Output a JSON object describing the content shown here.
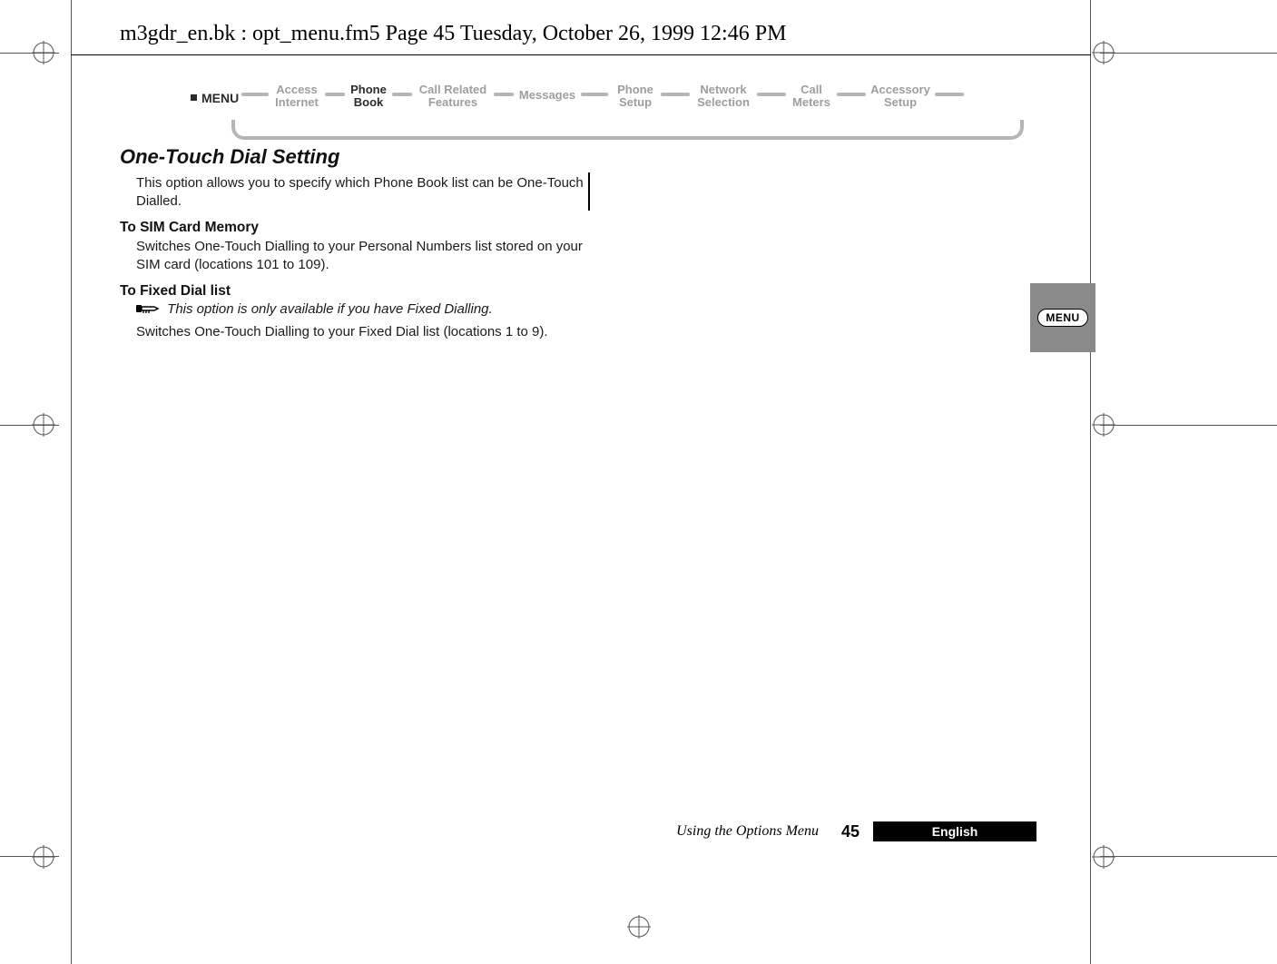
{
  "header": {
    "running_head": "m3gdr_en.bk : opt_menu.fm5  Page 45  Tuesday, October 26, 1999  12:46 PM"
  },
  "menu_strip": {
    "menu_label": "MENU",
    "items": [
      {
        "l1": "Access",
        "l2": "Internet",
        "active": false
      },
      {
        "l1": "Phone",
        "l2": "Book",
        "active": true
      },
      {
        "l1": "Call Related",
        "l2": "Features",
        "active": false
      },
      {
        "l1": "Messages",
        "l2": "",
        "active": false
      },
      {
        "l1": "Phone",
        "l2": "Setup",
        "active": false
      },
      {
        "l1": "Network",
        "l2": "Selection",
        "active": false
      },
      {
        "l1": "Call",
        "l2": "Meters",
        "active": false
      },
      {
        "l1": "Accessory",
        "l2": "Setup",
        "active": false
      }
    ]
  },
  "content": {
    "section_title": "One-Touch Dial Setting",
    "intro": "This option allows you to specify which Phone Book list can be One-Touch Dialled.",
    "sub1_title": "To SIM Card Memory",
    "sub1_body": "Switches One-Touch Dialling to your Personal Numbers list stored on your SIM card (locations 101 to 109).",
    "sub2_title": "To Fixed Dial list",
    "sub2_note": "This option is only available if you have Fixed Dialling.",
    "sub2_body": "Switches One-Touch Dialling to your Fixed Dial list (locations 1 to 9)."
  },
  "side_tab": {
    "label": "MENU"
  },
  "footer": {
    "section": "Using the Options Menu",
    "page_no": "45",
    "language": "English"
  }
}
